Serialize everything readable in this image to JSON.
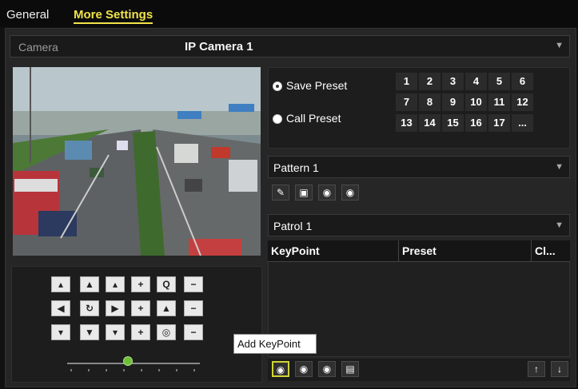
{
  "tabs": {
    "general": "General",
    "more_settings": "More Settings"
  },
  "camera": {
    "label": "Camera",
    "value": "IP Camera 1"
  },
  "preset": {
    "save_label": "Save Preset",
    "call_label": "Call Preset",
    "selected": "save",
    "numbers": [
      "1",
      "2",
      "3",
      "4",
      "5",
      "6",
      "7",
      "8",
      "9",
      "10",
      "11",
      "12",
      "13",
      "14",
      "15",
      "16",
      "17",
      "..."
    ]
  },
  "pattern": {
    "value": "Pattern 1"
  },
  "patrol": {
    "value": "Patrol 1"
  },
  "keypoint_table": {
    "headers": [
      "KeyPoint",
      "Preset",
      "Cl..."
    ]
  },
  "tooltip": "Add KeyPoint",
  "colors": {
    "accent_tab": "#f2e34a",
    "highlight": "#cfd533",
    "slider": "#6fbd3b"
  }
}
